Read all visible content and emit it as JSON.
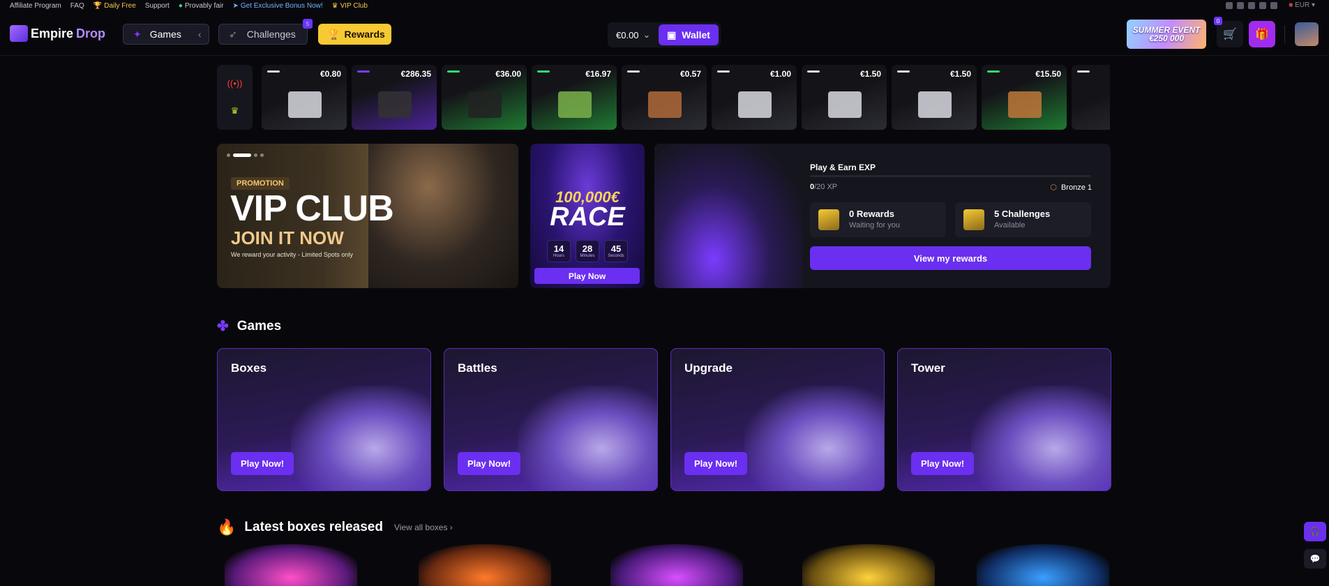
{
  "topbar": {
    "links": [
      {
        "label": "Affiliate Program",
        "style": "normal"
      },
      {
        "label": "FAQ",
        "style": "normal"
      },
      {
        "label": "Daily Free",
        "style": "gold",
        "icon": "trophy-icon"
      },
      {
        "label": "Support",
        "style": "normal"
      },
      {
        "label": "Provably fair",
        "style": "normal",
        "icon": "shield-icon"
      },
      {
        "label": "Get Exclusive Bonus Now!",
        "style": "blue",
        "icon": "telegram-icon"
      },
      {
        "label": "VIP Club",
        "style": "gold",
        "icon": "crown-icon"
      }
    ],
    "currency": "EUR"
  },
  "header": {
    "logo_text_1": "Empire",
    "logo_text_2": "Drop",
    "games_label": "Games",
    "challenges_label": "Challenges",
    "challenges_badge": "5",
    "rewards_label": "Rewards",
    "balance": "€0.00",
    "wallet_label": "Wallet",
    "summer_event": "SUMMER EVENT €250 000",
    "cart_badge": "0"
  },
  "drops": [
    {
      "price": "€0.80",
      "rarity": "grey"
    },
    {
      "price": "€286.35",
      "rarity": "purple"
    },
    {
      "price": "€36.00",
      "rarity": "green"
    },
    {
      "price": "€16.97",
      "rarity": "green"
    },
    {
      "price": "€0.57",
      "rarity": "grey"
    },
    {
      "price": "€1.00",
      "rarity": "grey"
    },
    {
      "price": "€1.50",
      "rarity": "grey"
    },
    {
      "price": "€1.50",
      "rarity": "grey"
    },
    {
      "price": "€15.50",
      "rarity": "orange"
    },
    {
      "price": "",
      "rarity": "grey"
    }
  ],
  "promo": {
    "tag": "PROMOTION",
    "title": "VIP CLUB",
    "subtitle": "JOIN IT NOW",
    "text": "We reward your activity - Limited Spots only"
  },
  "race": {
    "amount": "100,000€",
    "word": "RACE",
    "hours": "14",
    "hours_label": "Hours",
    "minutes": "28",
    "minutes_label": "Minutes",
    "seconds": "45",
    "seconds_label": "Seconds",
    "button": "Play Now"
  },
  "xp": {
    "title": "Play & Earn EXP",
    "current": "0",
    "total": "/20 XP",
    "rank": "Bronze 1",
    "rewards_title": "0 Rewards",
    "rewards_sub": "Waiting for you",
    "challenges_title": "5 Challenges",
    "challenges_sub": "Available",
    "button": "View my rewards"
  },
  "games_section": {
    "title": "Games",
    "cards": [
      {
        "title": "Boxes",
        "button": "Play Now!"
      },
      {
        "title": "Battles",
        "button": "Play Now!"
      },
      {
        "title": "Upgrade",
        "button": "Play Now!"
      },
      {
        "title": "Tower",
        "button": "Play Now!"
      }
    ]
  },
  "latest_section": {
    "title": "Latest boxes released",
    "view_all": "View all boxes"
  },
  "colors": {
    "accent": "#6a2ff0",
    "gold": "#f7c934",
    "background": "#08080c"
  }
}
